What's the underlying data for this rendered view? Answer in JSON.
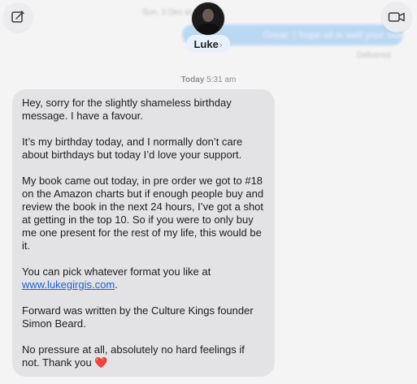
{
  "ghost": {
    "top_text": "Sun, 3 Dec at 4:05 pm",
    "outgoing_text": "Great :) hope all is well your side :)",
    "delivered": "Delivered"
  },
  "header": {
    "contact_name": "Luke",
    "chevron": "›",
    "compose_icon": "compose-icon",
    "video_icon": "video-camera-icon"
  },
  "thread": {
    "timestamp_day": "Today",
    "timestamp_time": "5:31 am"
  },
  "message": {
    "p1": "Hey, sorry for the slightly shameless birthday message. I have a favour.",
    "p2": "It’s my birthday today, and I normally don’t care about birthdays but today I’d love your support.",
    "p3": "My book came out today, in pre order we got to #18 on the Amazon charts but if enough people buy and review the book in the next 24 hours, I’ve got a shot at getting in the top 10. So if you were to only buy me one present for the rest of my life, this would be it.",
    "p4_prefix": "You can pick whatever format you like at",
    "link": "www.lukegirgis.com",
    "p4_suffix": ".",
    "p5": "Forward was written by the Culture Kings founder Simon Beard.",
    "p6": "No pressure at all, absolutely no hard feelings if not. Thank you",
    "emoji": "❤️"
  },
  "colors": {
    "incoming_bubble": "#e3e3e6",
    "link": "#1a5fd6",
    "heart": "#e0243a"
  }
}
